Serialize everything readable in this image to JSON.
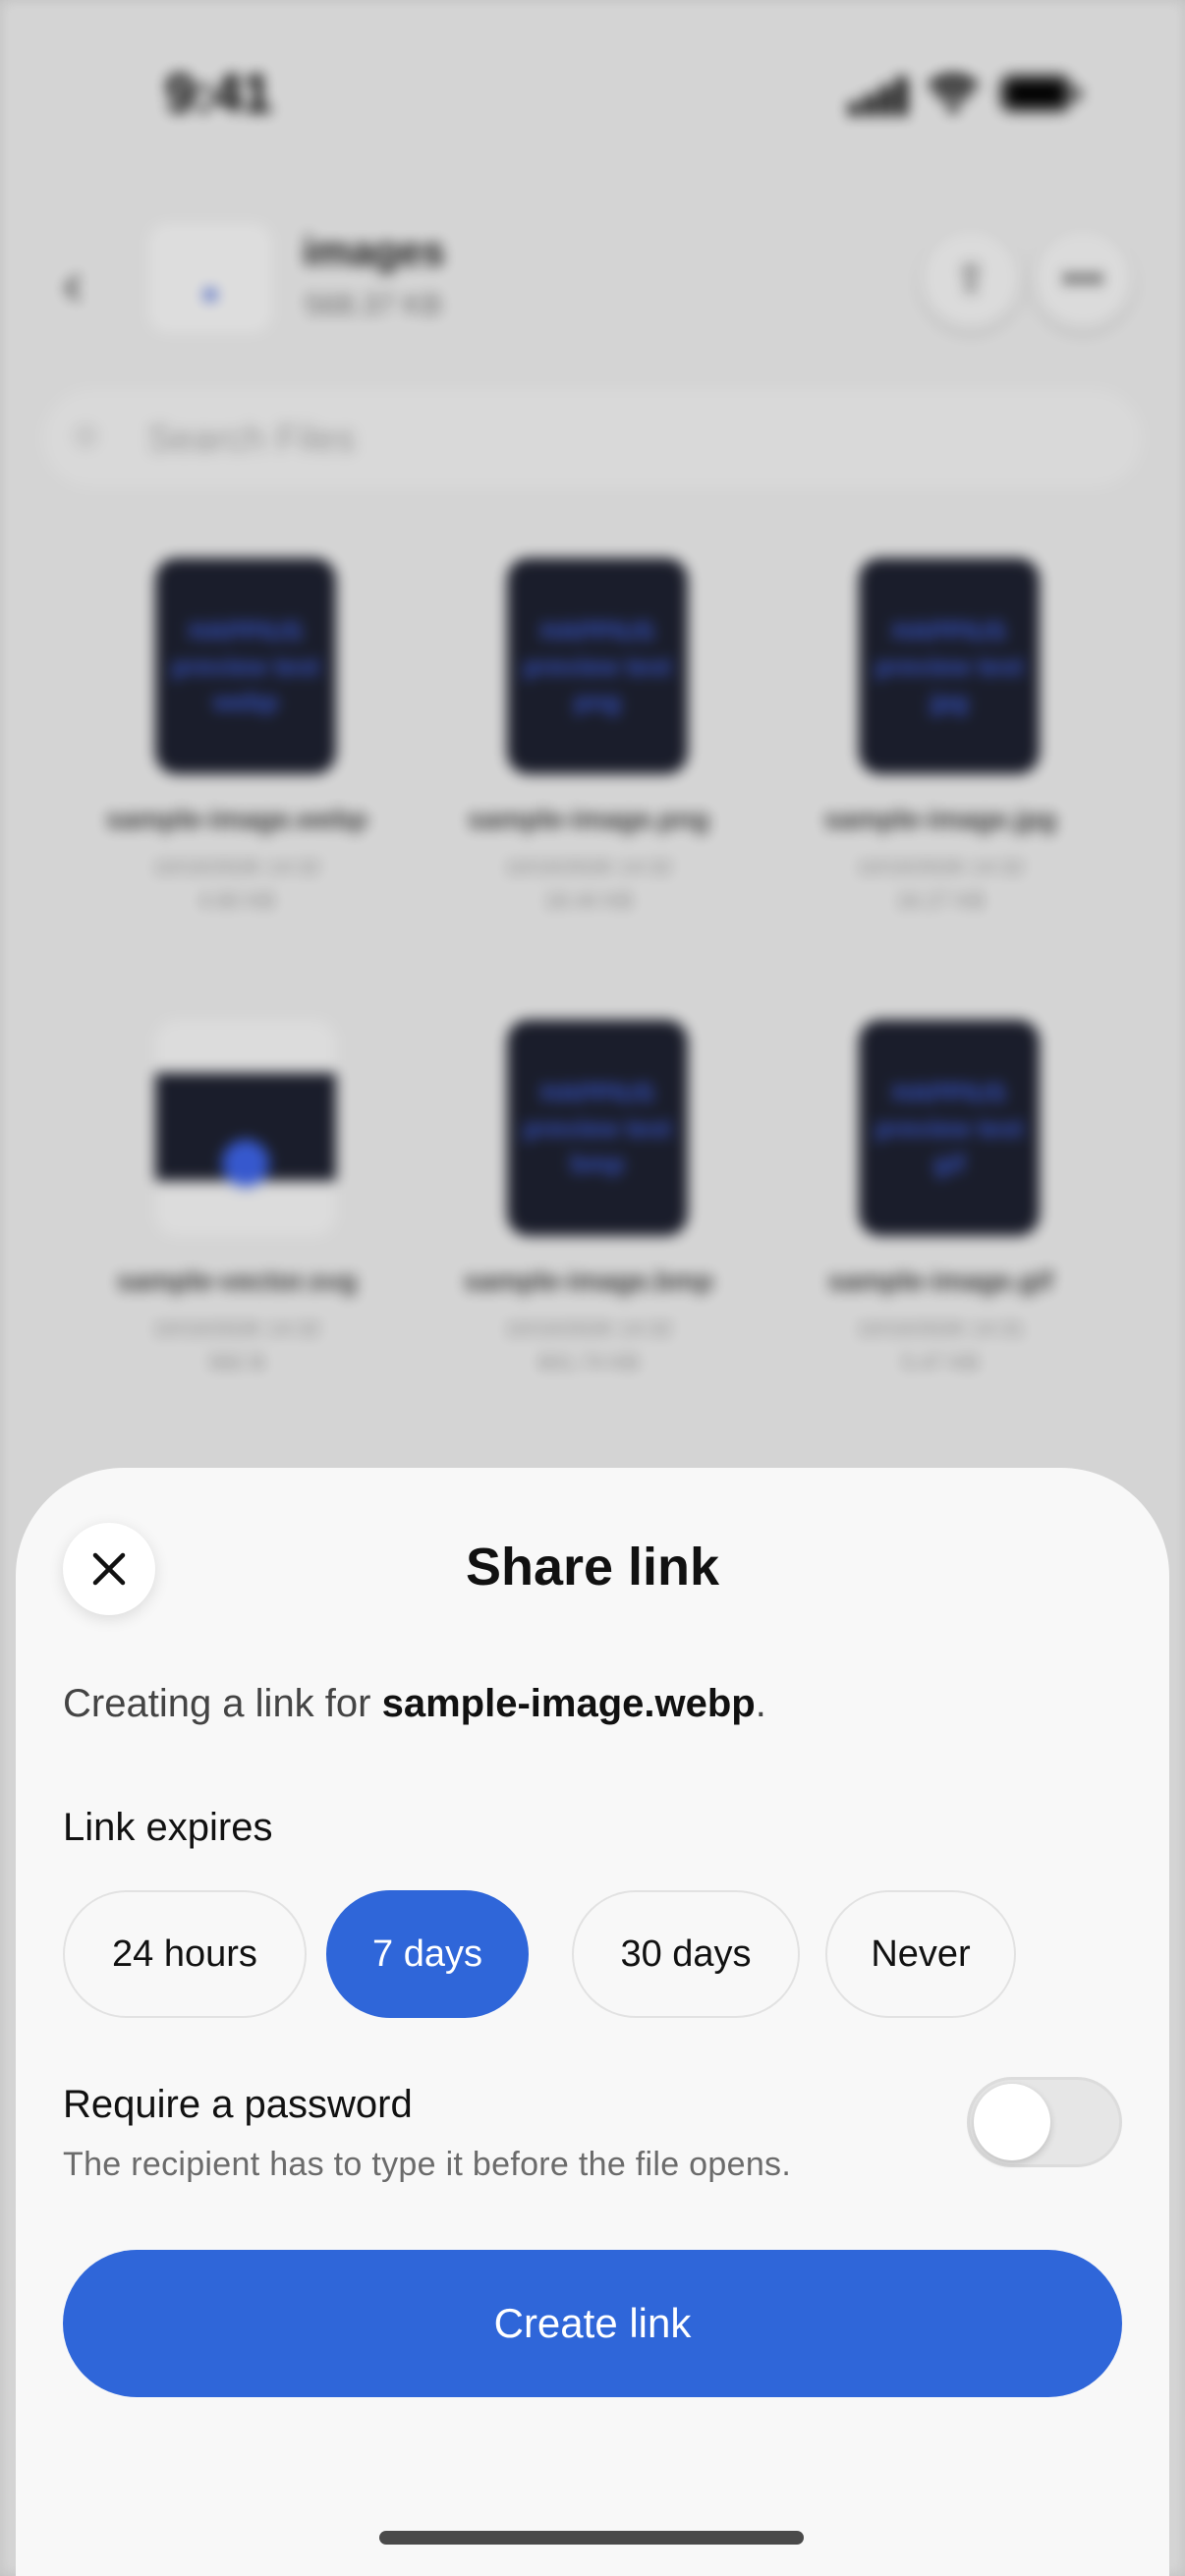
{
  "status_bar": {
    "time": "9:41"
  },
  "background": {
    "folder_title": "images",
    "folder_size": "568.37 KB",
    "search_placeholder": "Search Files",
    "files": [
      {
        "name": "sample-image.webp",
        "date": "10/10/2026 14:32",
        "size": "4.60 KB",
        "thumb_lines": [
          "HAPPIUS",
          "preview test",
          "webp"
        ]
      },
      {
        "name": "sample-image.png",
        "date": "10/10/2026 14:32",
        "size": "18.44 KB",
        "thumb_lines": [
          "HAPPIUS",
          "preview test",
          "png"
        ]
      },
      {
        "name": "sample-image.jpg",
        "date": "10/10/2026 14:32",
        "size": "16.27 KB",
        "thumb_lines": [
          "HAPPIUS",
          "preview test",
          "jpg"
        ]
      },
      {
        "name": "sample-vector.svg",
        "date": "10/10/2026 14:32",
        "size": "582 B",
        "thumb_lines": []
      },
      {
        "name": "sample-image.bmp",
        "date": "10/10/2026 14:32",
        "size": "601.74 KB",
        "thumb_lines": [
          "HAPPIUS",
          "preview test",
          "bmp"
        ]
      },
      {
        "name": "sample-image.gif",
        "date": "10/10/2026 14:31",
        "size": "5.47 KB",
        "thumb_lines": [
          "HAPPIUS",
          "preview test",
          "gif"
        ]
      }
    ]
  },
  "sheet": {
    "title": "Share link",
    "desc_prefix": "Creating a link for ",
    "desc_file": "sample-image.webp",
    "desc_suffix": ".",
    "expires_label": "Link expires",
    "expiry_options": [
      "24 hours",
      "7 days",
      "30 days",
      "Never"
    ],
    "selected_expiry": "7 days",
    "password_label": "Require a password",
    "password_sub": "The recipient has to type it before the file opens.",
    "password_enabled": false,
    "create_button": "Create link"
  },
  "colors": {
    "accent": "#2f66d9",
    "sheet_bg": "#f8f8f8"
  }
}
